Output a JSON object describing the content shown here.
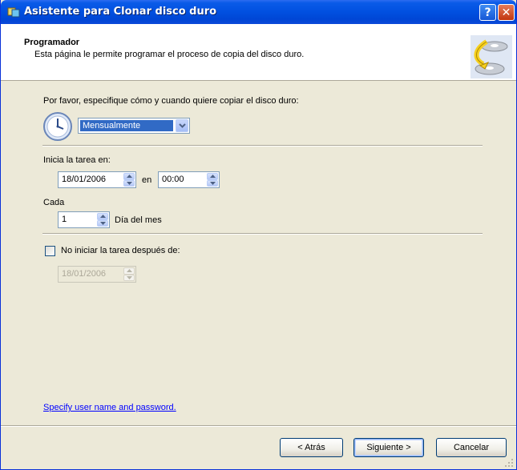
{
  "window": {
    "title": "Asistente para Clonar disco duro",
    "help_label": "?",
    "close_label": "✕"
  },
  "header": {
    "title": "Programador",
    "subtitle": "Esta página le permite programar el proceso de copia del disco duro."
  },
  "schedule": {
    "prompt": "Por favor, especifique cómo y cuando quiere copiar el disco duro:",
    "frequency": "Mensualmente"
  },
  "start": {
    "label": "Inicia la tarea en:",
    "date": "18/01/2006",
    "at_label": "en",
    "time": "00:00"
  },
  "every": {
    "label": "Cada",
    "value": "1",
    "unit": "Día del mes"
  },
  "end": {
    "checkbox_label": "No iniciar la tarea después de:",
    "checked": false,
    "date": "18/01/2006"
  },
  "link": {
    "label": "Specify user name and password."
  },
  "buttons": {
    "back": "< Atrás",
    "next": "Siguiente >",
    "cancel": "Cancelar"
  },
  "colors": {
    "titlebar": "#0150e0",
    "selection": "#316ac5",
    "link": "#0000ff",
    "face": "#ece9d8"
  }
}
